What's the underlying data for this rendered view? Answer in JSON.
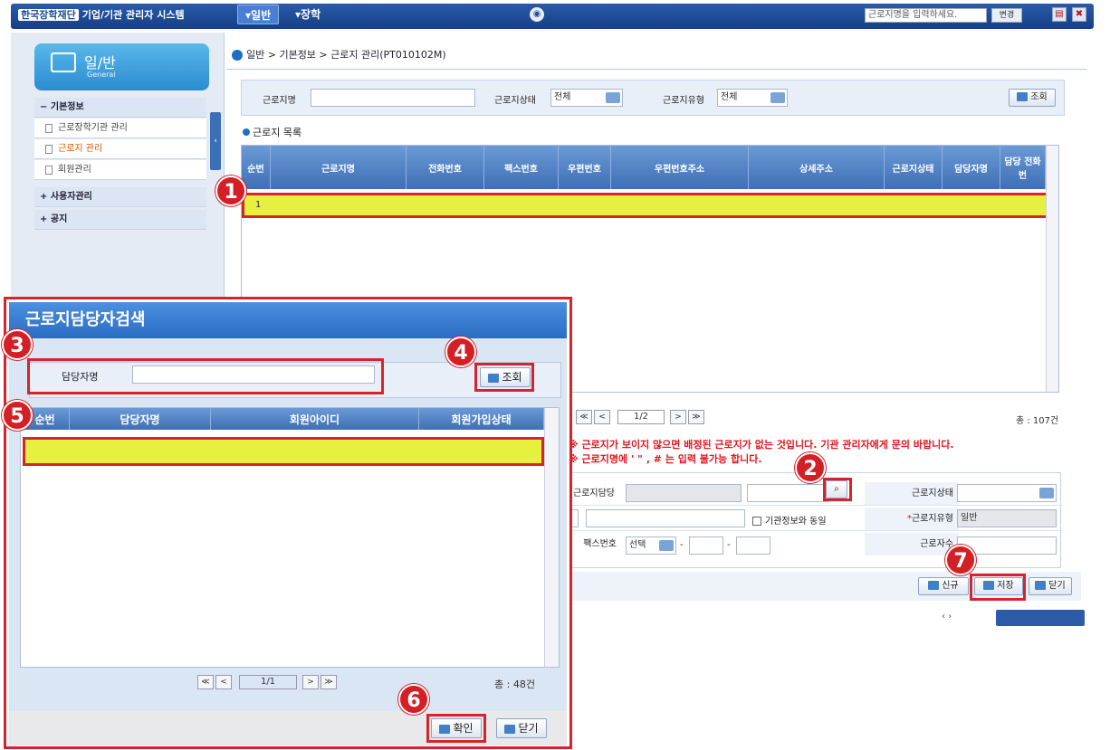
{
  "topbar": {
    "logo_text": "한국장학재단",
    "system_title": "기업/기관 관리자 시스템",
    "menu": [
      "▾일반",
      "▾장학"
    ],
    "search_placeholder": "근로지명을 입력하세요.",
    "go_label": "변경"
  },
  "sidebar": {
    "general_title": "일/반",
    "general_sub": "General",
    "items": [
      {
        "label": "기본정보",
        "sign": "−"
      },
      {
        "label": "근로장학기관 관리"
      },
      {
        "label": "근로지 관리"
      },
      {
        "label": "회원관리"
      },
      {
        "label": "사용자관리",
        "sign": "+"
      },
      {
        "label": "공지",
        "sign": "+"
      }
    ]
  },
  "breadcrumb": "일반 > 기본정보 > 근로지 관리(PT010102M)",
  "search": {
    "name_label": "근로지명",
    "status_label": "근로지상태",
    "status_value": "전체",
    "type_label": "근로지유형",
    "type_value": "전체",
    "query_button": "조회"
  },
  "list_title": "근로지 목록",
  "grid": {
    "columns": [
      "순번",
      "근로지명",
      "전화번호",
      "팩스번호",
      "우편번호",
      "우편번호주소",
      "상세주소",
      "근로지상태",
      "담당자명",
      "담당 전화번"
    ],
    "row": [
      "1"
    ],
    "pager": {
      "first": "≪",
      "prev": "<",
      "page": "1/2",
      "next": ">",
      "last": "≫"
    },
    "total": "총 : 107건"
  },
  "warnings": [
    "※ 근로지가 보이지 않으면 배정된 근로지가 없는 것입니다. 기관 관리자에게 문의 바랍니다.",
    "※ 근로지명에 ' \" ‚ # 는 입력 불가능 합니다."
  ],
  "form": {
    "manager_label": "근로지담당자",
    "status_label": "근로지상태",
    "same_label": "기관정보와 동일",
    "type_label": "근로지유형",
    "type_value": "일반",
    "required_mark": "*",
    "fax_label": "팩스번호",
    "fax_select": "선택",
    "count_label": "근로자수",
    "dash": "-"
  },
  "actions": {
    "new": "신규",
    "save": "저장",
    "close": "닫기"
  },
  "modal": {
    "title": "근로지담당자검색",
    "name_label": "담당자명",
    "query_button": "조회",
    "columns": [
      "순번",
      "담당자명",
      "회원아이디",
      "회원가입상태"
    ],
    "pager": {
      "first": "≪",
      "prev": "<",
      "page": "1/1",
      "next": ">",
      "last": "≫"
    },
    "total": "총 : 48건",
    "ok_button": "확인",
    "close_button": "닫기"
  },
  "markers": [
    "1",
    "2",
    "3",
    "4",
    "5",
    "6",
    "7"
  ],
  "colors": {
    "accent": "#1d4a95",
    "highlight": "#e6f03e",
    "callout": "#d41f26"
  }
}
